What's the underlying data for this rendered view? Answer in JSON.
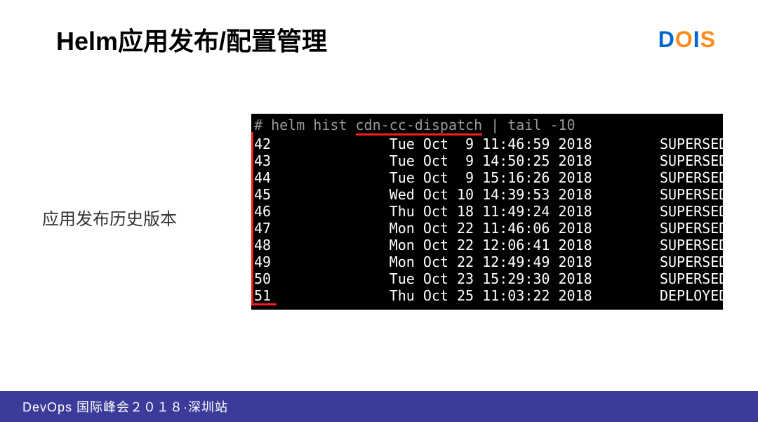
{
  "title": "Helm应用发布/配置管理",
  "logo": {
    "d": "D",
    "o": "O",
    "i": "I",
    "s": "S"
  },
  "sideLabel": "应用发布历史版本",
  "terminal": {
    "prompt": "# helm hist ",
    "cmd_redacted": "cdn-cc-dispatch",
    "cmd_tail": " | tail -10",
    "rows": [
      {
        "rev": "42",
        "date": "Tue Oct  9 11:46:59 2018",
        "status": "SUPERSEDED"
      },
      {
        "rev": "43",
        "date": "Tue Oct  9 14:50:25 2018",
        "status": "SUPERSEDED"
      },
      {
        "rev": "44",
        "date": "Tue Oct  9 15:16:26 2018",
        "status": "SUPERSEDED"
      },
      {
        "rev": "45",
        "date": "Wed Oct 10 14:39:53 2018",
        "status": "SUPERSEDED"
      },
      {
        "rev": "46",
        "date": "Thu Oct 18 11:49:24 2018",
        "status": "SUPERSEDED"
      },
      {
        "rev": "47",
        "date": "Mon Oct 22 11:46:06 2018",
        "status": "SUPERSEDED"
      },
      {
        "rev": "48",
        "date": "Mon Oct 22 12:06:41 2018",
        "status": "SUPERSEDED"
      },
      {
        "rev": "49",
        "date": "Mon Oct 22 12:49:49 2018",
        "status": "SUPERSEDED"
      },
      {
        "rev": "50",
        "date": "Tue Oct 23 15:29:30 2018",
        "status": "SUPERSEDED"
      },
      {
        "rev": "51",
        "date": "Thu Oct 25 11:03:22 2018",
        "status": "DEPLOYED"
      }
    ]
  },
  "footer": "DevOps 国际峰会２０１８·深圳站"
}
